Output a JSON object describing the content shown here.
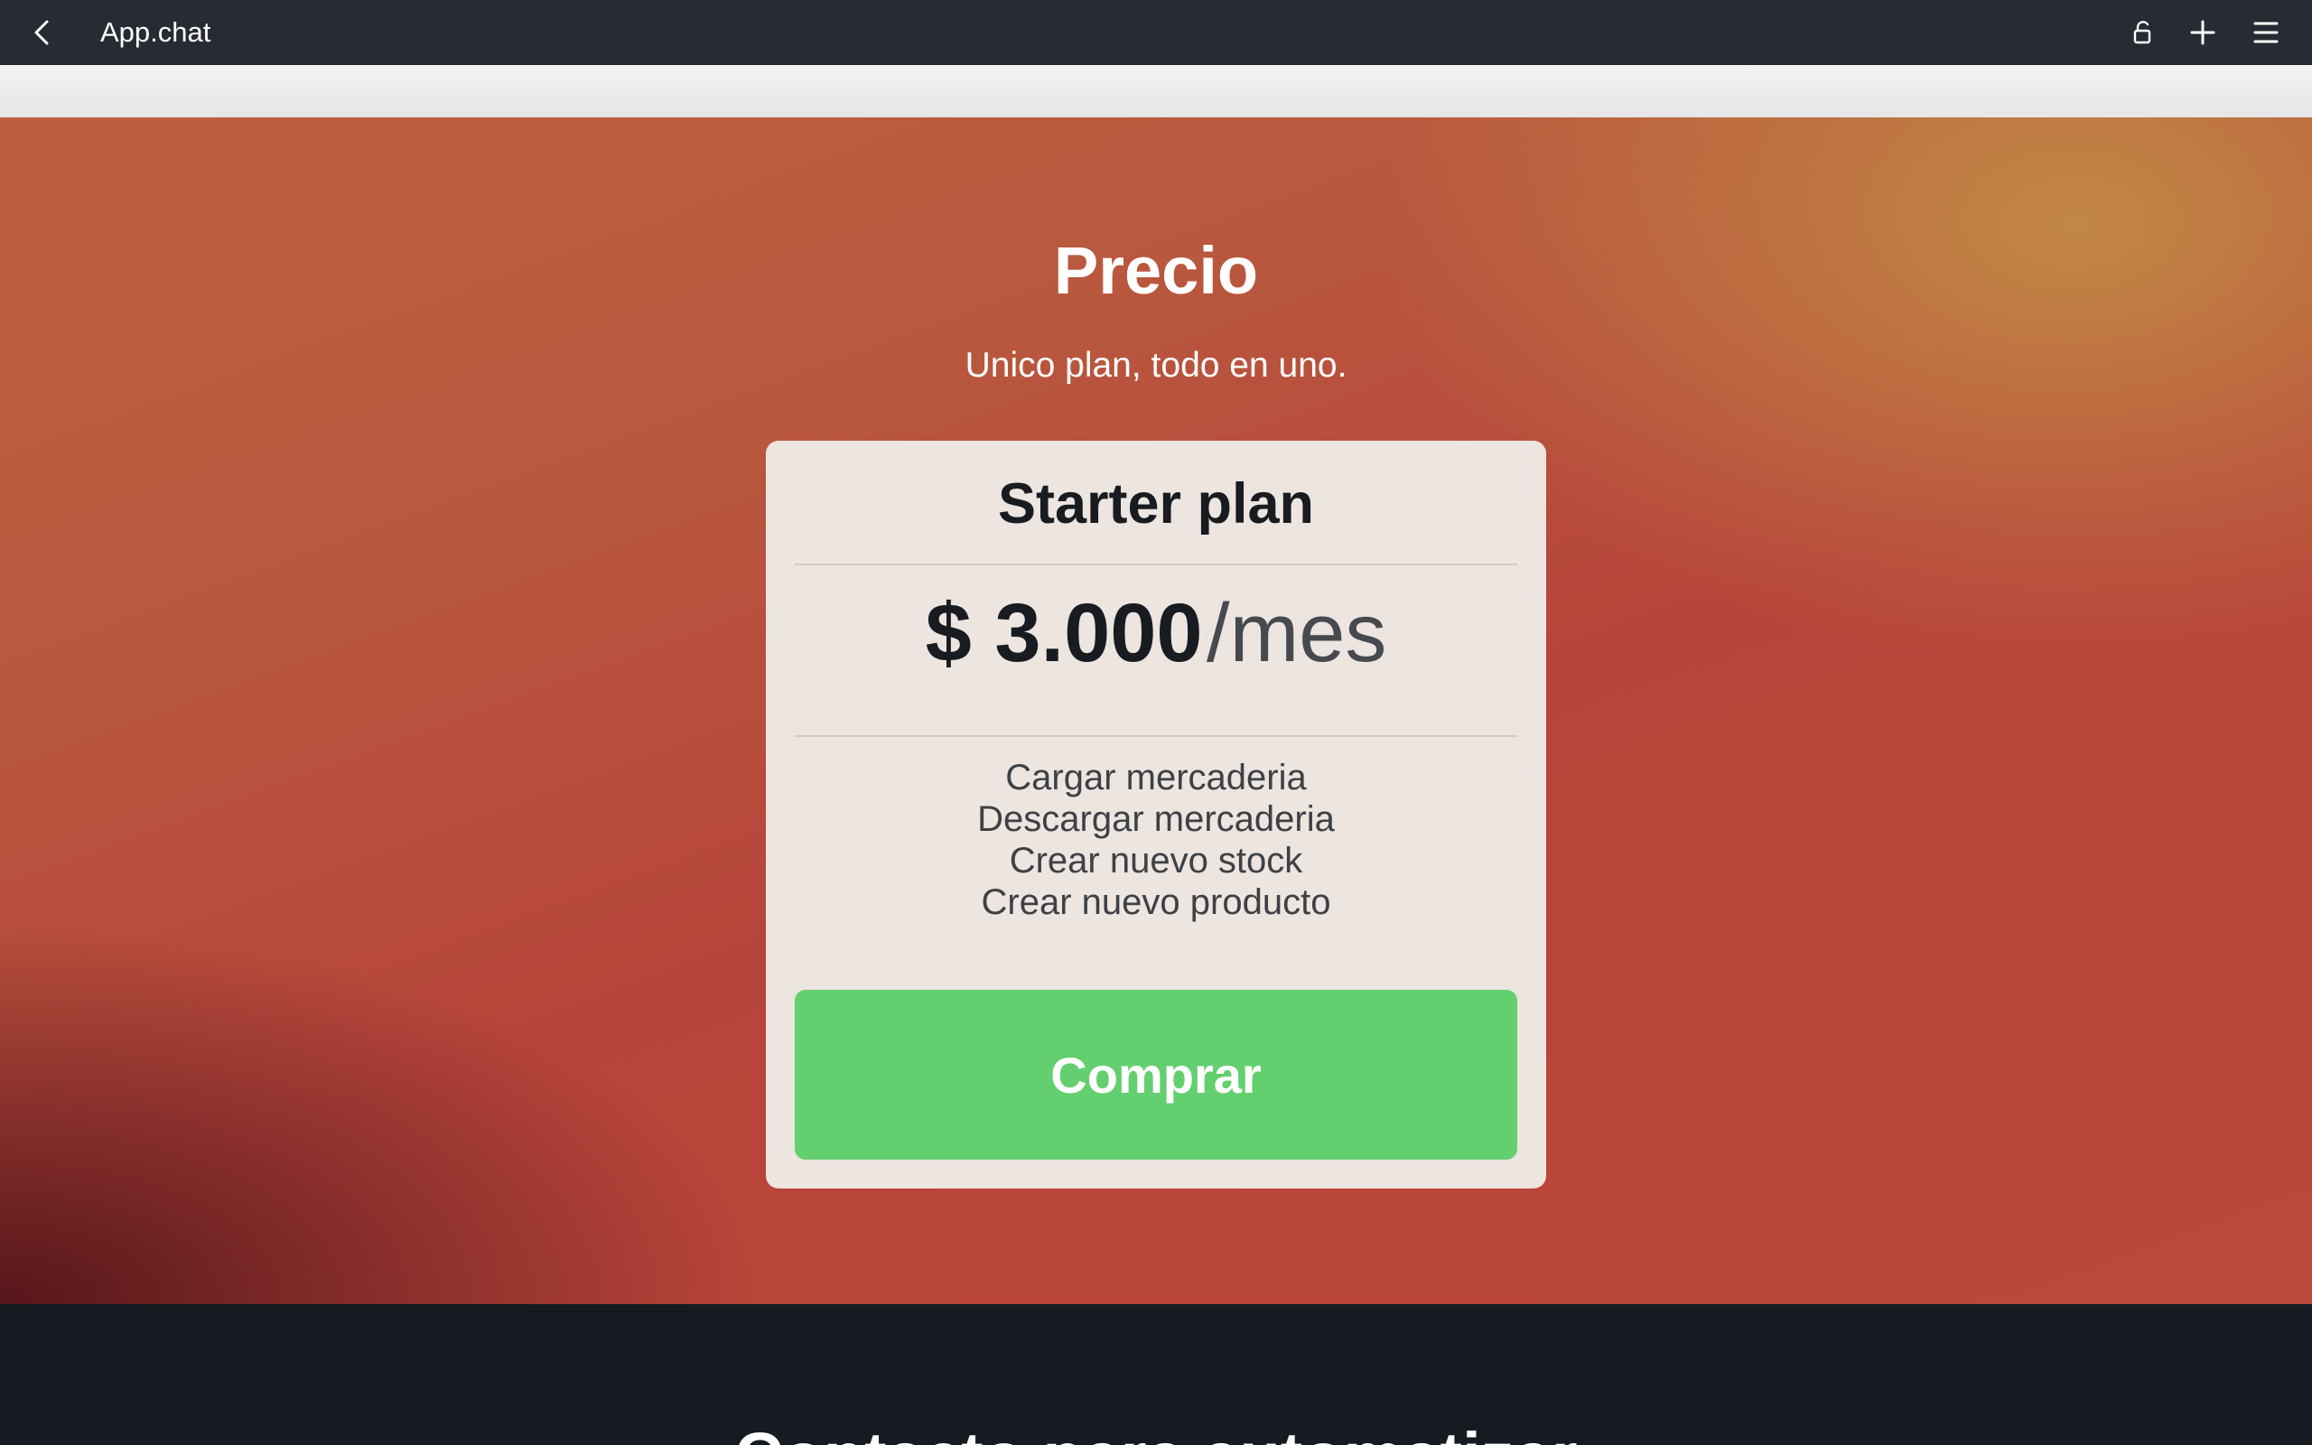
{
  "titlebar": {
    "title": "App.chat",
    "icons": [
      "chevron-left-icon",
      "lock-icon",
      "plus-icon",
      "hamburger-menu-icon"
    ]
  },
  "pricing": {
    "heading": "Precio",
    "subheading": "Unico plan, todo en uno.",
    "plan": {
      "name": "Starter plan",
      "price": "$ 3.000",
      "period": "/mes",
      "features": [
        "Cargar mercaderia",
        "Descargar mercaderia",
        "Crear nuevo stock",
        "Crear nuevo producto"
      ],
      "cta_label": "Comprar"
    }
  },
  "next_section": {
    "heading": "Contacto para automatizar"
  },
  "colors": {
    "titlebar_bg": "#272b33",
    "card_bg": "#ece5e0",
    "button_green": "#64cf6f",
    "footer_bg": "#161b21"
  }
}
